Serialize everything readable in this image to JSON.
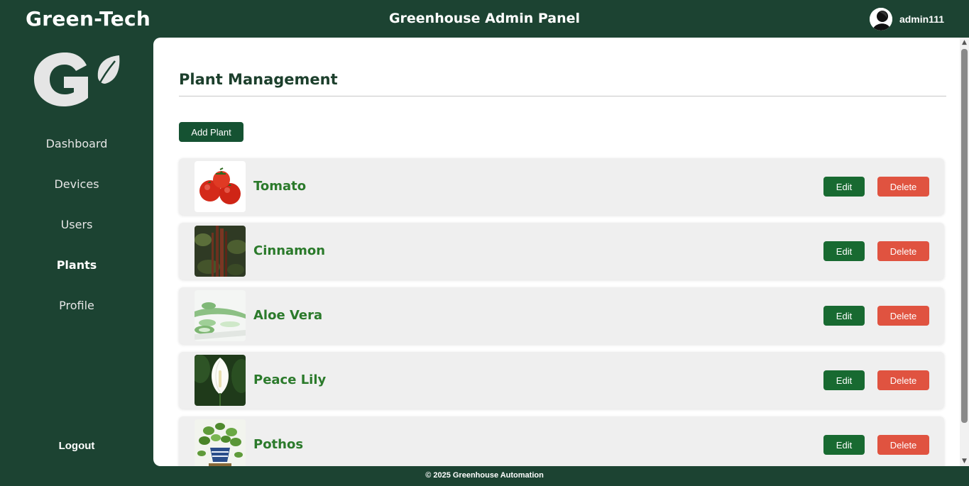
{
  "header": {
    "brand": "Green-Tech",
    "title": "Greenhouse Admin Panel",
    "username": "admin111"
  },
  "sidebar": {
    "items": [
      {
        "label": "Dashboard",
        "active": false
      },
      {
        "label": "Devices",
        "active": false
      },
      {
        "label": "Users",
        "active": false
      },
      {
        "label": "Plants",
        "active": true
      },
      {
        "label": "Profile",
        "active": false
      }
    ],
    "logout_label": "Logout"
  },
  "main": {
    "page_title": "Plant Management",
    "add_button_label": "Add Plant",
    "plants": [
      {
        "name": "Tomato",
        "image_icon": "tomato-photo"
      },
      {
        "name": "Cinnamon",
        "image_icon": "cinnamon-photo"
      },
      {
        "name": "Aloe Vera",
        "image_icon": "aloe-vera-photo"
      },
      {
        "name": "Peace Lily",
        "image_icon": "peace-lily-photo"
      },
      {
        "name": "Pothos",
        "image_icon": "pothos-photo"
      }
    ],
    "edit_label": "Edit",
    "delete_label": "Delete"
  },
  "footer": {
    "text": "© 2025 Greenhouse Automation"
  },
  "colors": {
    "sidebar_bg": "#1c4332",
    "primary_button": "#155232",
    "edit_button": "#186a31",
    "delete_button": "#e05340",
    "plant_name": "#2b7a2b"
  }
}
